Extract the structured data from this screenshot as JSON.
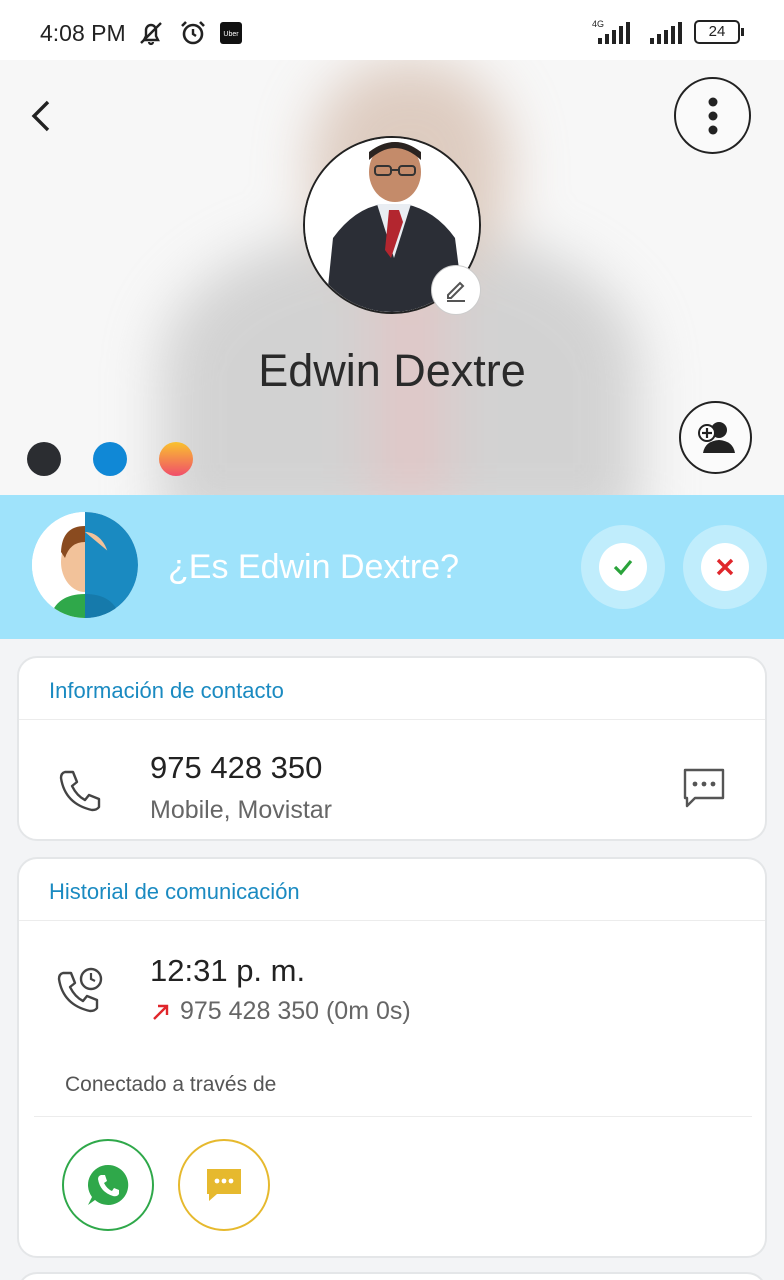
{
  "status_bar": {
    "time": "4:08 PM",
    "network": "4G",
    "battery": "24"
  },
  "contact": {
    "name": "Edwin Dextre"
  },
  "theme_colors": [
    "#2b2d31",
    "#1088d6",
    "#f56a4d"
  ],
  "banner": {
    "question": "¿Es Edwin Dextre?"
  },
  "contact_info": {
    "title": "Información de contacto",
    "phone": "975 428 350",
    "phone_type": "Mobile, Movistar"
  },
  "history": {
    "title": "Historial de comunicación",
    "time": "12:31 p. m.",
    "detail": "975 428 350 (0m 0s)",
    "connected_label": "Conectado a través de"
  },
  "colors": {
    "accent": "#1a8ac1",
    "banner": "#9fe3fb",
    "confirm": "#2aa33b",
    "reject": "#e0262b",
    "whatsapp": "#2fa84a",
    "sms": "#e6b92e"
  }
}
